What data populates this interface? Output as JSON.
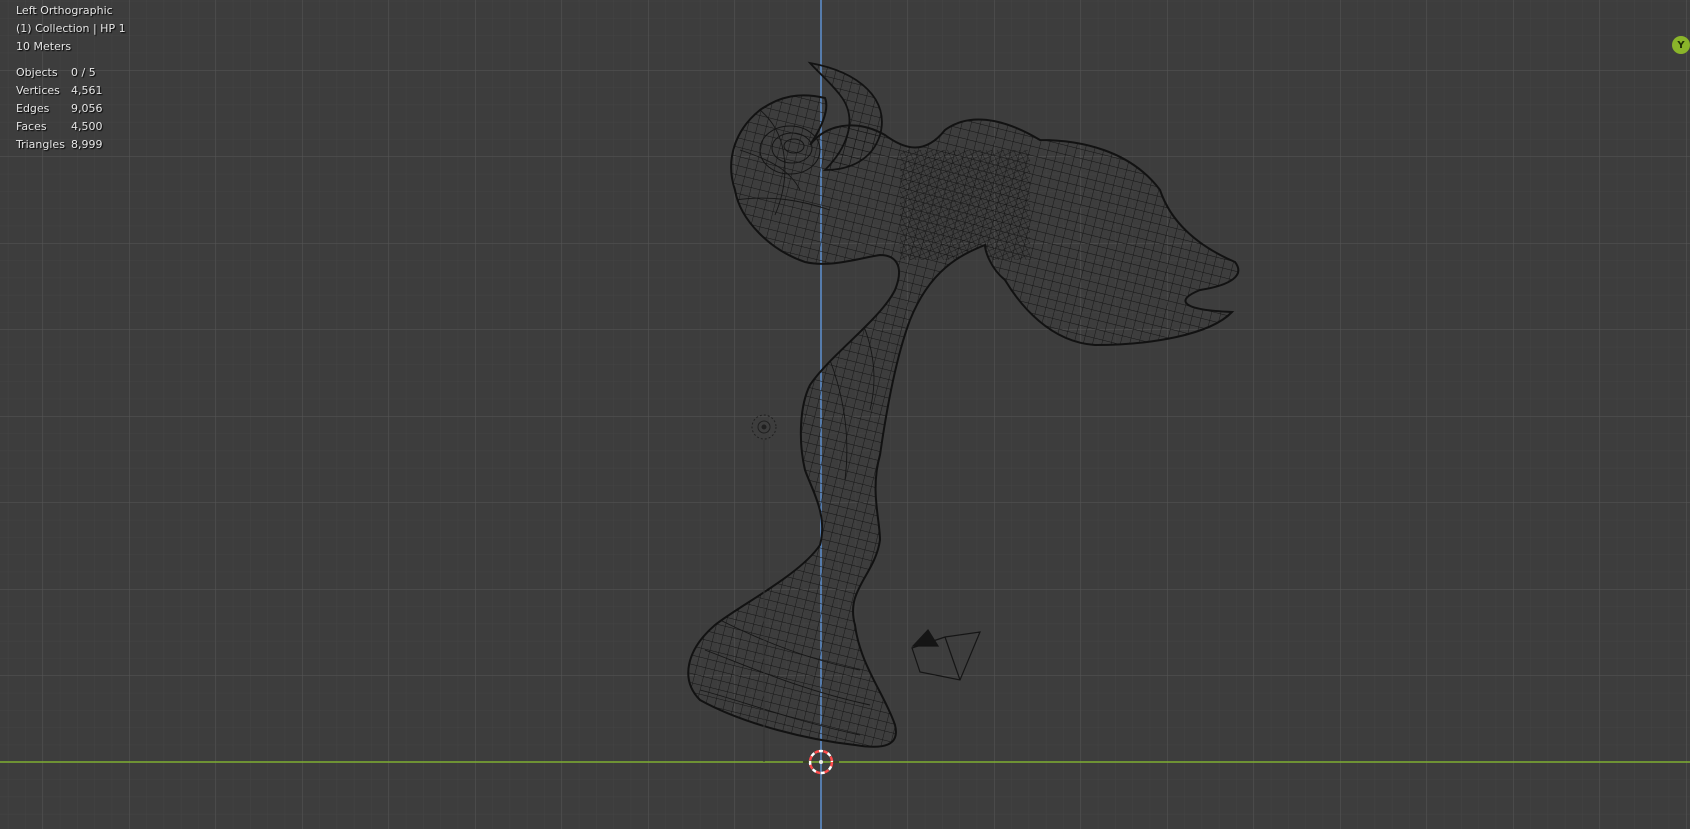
{
  "viewport": {
    "view_name": "Left Orthographic",
    "collection_label": "(1) Collection | HP 1",
    "scale_label": "10 Meters"
  },
  "stats": [
    {
      "label": "Objects",
      "value": "0 / 5"
    },
    {
      "label": "Vertices",
      "value": "4,561"
    },
    {
      "label": "Edges",
      "value": "9,056"
    },
    {
      "label": "Faces",
      "value": "4,500"
    },
    {
      "label": "Triangles",
      "value": "8,999"
    }
  ],
  "gizmo": {
    "axis_label": "Y",
    "axis_color": "#8ab52a"
  },
  "colors": {
    "background": "#3d3d3d",
    "grid_minor": "#474747",
    "grid_major": "#565656",
    "y_axis": "#5c8cc8",
    "z_axis": "#7fae32",
    "wire": "#151515"
  }
}
